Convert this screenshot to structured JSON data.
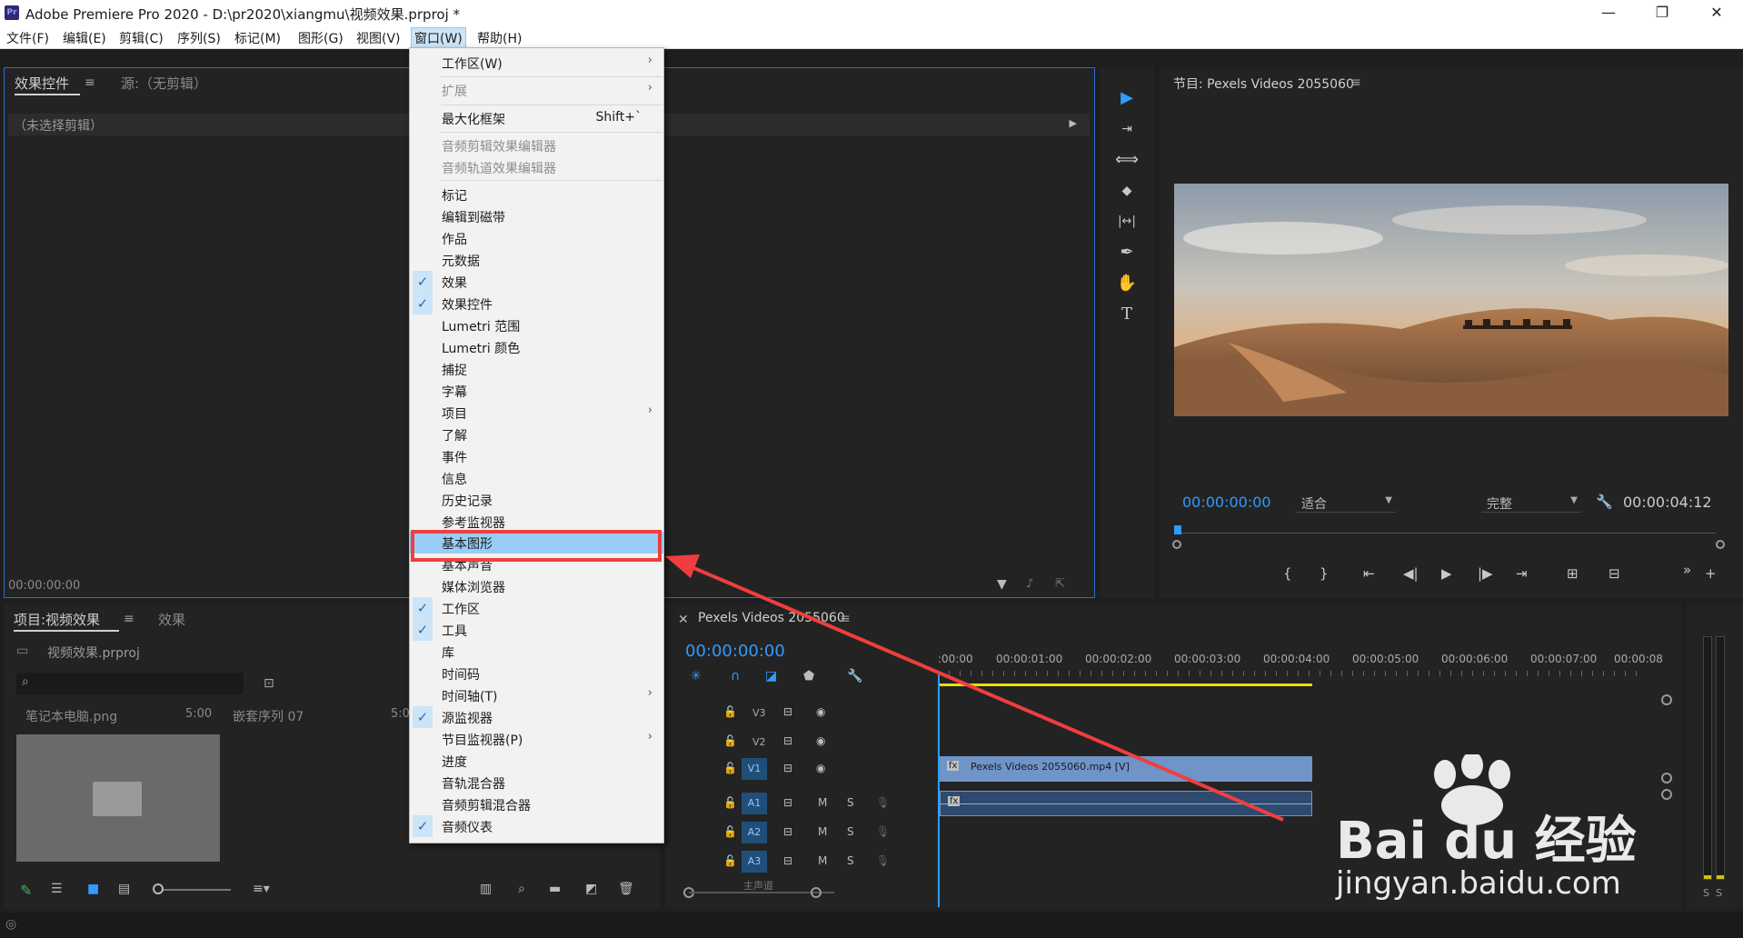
{
  "window": {
    "title": "Adobe Premiere Pro 2020 - D:\\pr2020\\xiangmu\\视频效果.prproj *",
    "logo": "Pr",
    "minimize": "—",
    "restore": "❐",
    "close": "✕"
  },
  "menubar": [
    "文件(F)",
    "编辑(E)",
    "剪辑(C)",
    "序列(S)",
    "标记(M)",
    "图形(G)",
    "视图(V)",
    "窗口(W)",
    "帮助(H)"
  ],
  "effect_controls": {
    "tab_active": "效果控件",
    "tab_source": "源:（无剪辑）",
    "no_clip": "（未选择剪辑）",
    "timecode": "00:00:00:00"
  },
  "window_menu": {
    "items": [
      {
        "label": "工作区(W)",
        "submenu": true
      },
      {
        "label": "扩展",
        "submenu": true,
        "disabled": true
      },
      {
        "label": "最大化框架",
        "shortcut": "Shift+`"
      },
      {
        "label": "音频剪辑效果编辑器",
        "disabled": true
      },
      {
        "label": "音频轨道效果编辑器",
        "disabled": true
      },
      {
        "label": "标记"
      },
      {
        "label": "编辑到磁带"
      },
      {
        "label": "作品"
      },
      {
        "label": "元数据"
      },
      {
        "label": "效果",
        "checked": true
      },
      {
        "label": "效果控件",
        "checked": true
      },
      {
        "label": "Lumetri 范围"
      },
      {
        "label": "Lumetri 颜色"
      },
      {
        "label": "捕捉"
      },
      {
        "label": "字幕"
      },
      {
        "label": "项目",
        "submenu": true
      },
      {
        "label": "了解"
      },
      {
        "label": "事件"
      },
      {
        "label": "信息"
      },
      {
        "label": "历史记录"
      },
      {
        "label": "参考监视器"
      },
      {
        "label": "基本图形",
        "highlighted": true
      },
      {
        "label": "基本声音"
      },
      {
        "label": "媒体浏览器"
      },
      {
        "label": "工作区",
        "checked": true
      },
      {
        "label": "工具",
        "checked": true
      },
      {
        "label": "库"
      },
      {
        "label": "时间码"
      },
      {
        "label": "时间轴(T)",
        "submenu": true
      },
      {
        "label": "源监视器",
        "checked": true
      },
      {
        "label": "节目监视器(P)",
        "submenu": true
      },
      {
        "label": "进度"
      },
      {
        "label": "音轨混合器"
      },
      {
        "label": "音频剪辑混合器"
      },
      {
        "label": "音频仪表",
        "checked": true
      }
    ]
  },
  "program_monitor": {
    "title": "节目: Pexels Videos 2055060",
    "timecode_current": "00:00:00:00",
    "fit": "适合",
    "quality": "完整",
    "timecode_duration": "00:00:04:12"
  },
  "project_panel": {
    "tab_active": "项目:视频效果",
    "tab_effects": "效果",
    "filename": "视频效果.prproj",
    "items": [
      {
        "name": "笔记本电脑.png",
        "duration": "5:00"
      },
      {
        "name": "嵌套序列 07",
        "duration": "5:0"
      }
    ]
  },
  "timeline": {
    "sequence_title": "Pexels Videos 2055060",
    "timecode": "00:00:00:00",
    "ruler": [
      ":00:00",
      "00:00:01:00",
      "00:00:02:00",
      "00:00:03:00",
      "00:00:04:00",
      "00:00:05:00",
      "00:00:06:00",
      "00:00:07:00",
      "00:00:08"
    ],
    "video_tracks": [
      "V3",
      "V2",
      "V1"
    ],
    "audio_tracks": [
      "A1",
      "A2",
      "A3"
    ],
    "clip_label": "Pexels Videos 2055060.mp4 [V]",
    "fx": "fx",
    "m": "M",
    "s": "S",
    "master": "主声道"
  },
  "meters": {
    "s1": "S",
    "s2": "S"
  },
  "watermark": {
    "brand": "Bai du 经验",
    "url": "jingyan.baidu.com"
  },
  "icons": {
    "selection": "▶",
    "track_select": "⇥",
    "ripple": "⟺",
    "razor": "◆",
    "slip": "|↔|",
    "pen": "✒",
    "hand": "✋",
    "type": "T"
  },
  "colors": {
    "accent_blue": "#2f9bff",
    "highlight": "#99cdf5",
    "annotation_red": "#f03e3e",
    "clip_blue": "#6e94c8",
    "workarea_yellow": "#e8e000"
  }
}
